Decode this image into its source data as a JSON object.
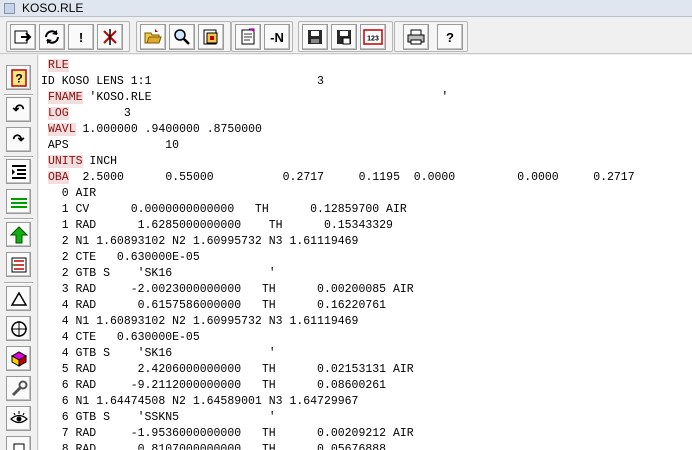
{
  "window": {
    "title": "KOSO.RLE"
  },
  "toolbar": {
    "buttons": [
      {
        "name": "import-button",
        "icon": "import-icon",
        "label": ""
      },
      {
        "name": "refresh-button",
        "icon": "refresh-icon",
        "label": ""
      },
      {
        "name": "exclaim-button",
        "icon": "exclaim-icon",
        "label": "!"
      },
      {
        "name": "clear-button",
        "icon": "strike-x-icon",
        "label": ""
      },
      {
        "name": "open-button",
        "icon": "open-folder-icon",
        "label": ""
      },
      {
        "name": "find-button",
        "icon": "magnifier-icon",
        "label": ""
      },
      {
        "name": "browse-button",
        "icon": "browse-icon",
        "label": ""
      },
      {
        "name": "edit-button",
        "icon": "notepad-icon",
        "label": ""
      },
      {
        "name": "minus-n-button",
        "icon": "",
        "label": "-N"
      },
      {
        "name": "save-button",
        "icon": "floppy-icon",
        "label": ""
      },
      {
        "name": "save-as-button",
        "icon": "floppy-as-icon",
        "label": ""
      },
      {
        "name": "number-button",
        "icon": "numbers-icon",
        "label": "123"
      },
      {
        "name": "print-button",
        "icon": "printer-icon",
        "label": ""
      },
      {
        "name": "help-button",
        "icon": "question-icon",
        "label": "?"
      }
    ]
  },
  "sidebar": {
    "buttons": [
      {
        "name": "help-button",
        "icon": "question-icon",
        "label": "?"
      },
      {
        "name": "undo-button",
        "icon": "undo-icon",
        "label": "↶"
      },
      {
        "name": "redo-button",
        "icon": "redo-icon",
        "label": "↷"
      },
      {
        "name": "indent-button",
        "icon": "indent-icon",
        "label": ""
      },
      {
        "name": "align-button",
        "icon": "lines-icon",
        "label": ""
      },
      {
        "name": "up-arrow-button",
        "icon": "up-arrow-icon",
        "label": ""
      },
      {
        "name": "list-button",
        "icon": "list-icon",
        "label": ""
      },
      {
        "name": "triangle-button",
        "icon": "triangle-icon",
        "label": ""
      },
      {
        "name": "target-button",
        "icon": "crosshair-icon",
        "label": ""
      },
      {
        "name": "shape-button",
        "icon": "shape-icon",
        "label": ""
      },
      {
        "name": "wrench-button",
        "icon": "wrench-icon",
        "label": ""
      },
      {
        "name": "view-button",
        "icon": "eye-icon",
        "label": ""
      },
      {
        "name": "extra-button",
        "icon": "box-icon",
        "label": ""
      }
    ]
  },
  "editor": {
    "lines": [
      {
        "kw": "RLE",
        "rest": ""
      },
      {
        "kw": "",
        "rest": "ID KOSO LENS 1:1                        3"
      },
      {
        "kw": "FNAME",
        "rest": " 'KOSO.RLE                                          '"
      },
      {
        "kw": "LOG",
        "rest": "        3"
      },
      {
        "kw": "WAVL",
        "rest": " 1.000000 .9400000 .8750000"
      },
      {
        "kw": "",
        "rest": " APS              10"
      },
      {
        "kw": "UNITS",
        "rest": " INCH"
      },
      {
        "kw": "OBA",
        "rest": "  2.5000      0.55000          0.2717     0.1195  0.0000         0.0000     0.2717"
      },
      {
        "kw": "",
        "rest": "   0 AIR"
      },
      {
        "kw": "",
        "rest": "   1 CV      0.0000000000000   TH      0.12859700 AIR"
      },
      {
        "kw": "",
        "rest": "   1 RAD      1.6285000000000    TH      0.15343329"
      },
      {
        "kw": "",
        "rest": "   2 N1 1.60893102 N2 1.60995732 N3 1.61119469"
      },
      {
        "kw": "",
        "rest": "   2 CTE   0.630000E-05"
      },
      {
        "kw": "",
        "rest": "   2 GTB S    'SK16              '"
      },
      {
        "kw": "",
        "rest": "   3 RAD     -2.0023000000000   TH      0.00200085 AIR"
      },
      {
        "kw": "",
        "rest": "   4 RAD      0.6157586000000   TH      0.16220761"
      },
      {
        "kw": "",
        "rest": "   4 N1 1.60893102 N2 1.60995732 N3 1.61119469"
      },
      {
        "kw": "",
        "rest": "   4 CTE   0.630000E-05"
      },
      {
        "kw": "",
        "rest": "   4 GTB S    'SK16              '"
      },
      {
        "kw": "",
        "rest": "   5 RAD      2.4206000000000   TH      0.02153131 AIR"
      },
      {
        "kw": "",
        "rest": "   6 RAD     -9.2112000000000   TH      0.08600261"
      },
      {
        "kw": "",
        "rest": "   6 N1 1.64474508 N2 1.64589001 N3 1.64729967"
      },
      {
        "kw": "",
        "rest": "   6 GTB S    'SSKN5             '"
      },
      {
        "kw": "",
        "rest": "   7 RAD     -1.9536000000000   TH      0.00209212 AIR"
      },
      {
        "kw": "",
        "rest": "   8 RAD      0.8107000000000   TH      0.05676888"
      }
    ]
  },
  "colors": {
    "keyword_bg": "#f2dede",
    "keyword_fg": "#8b1010",
    "editor_bg": "#ffffff",
    "chrome_bg": "#f0f0f0"
  }
}
